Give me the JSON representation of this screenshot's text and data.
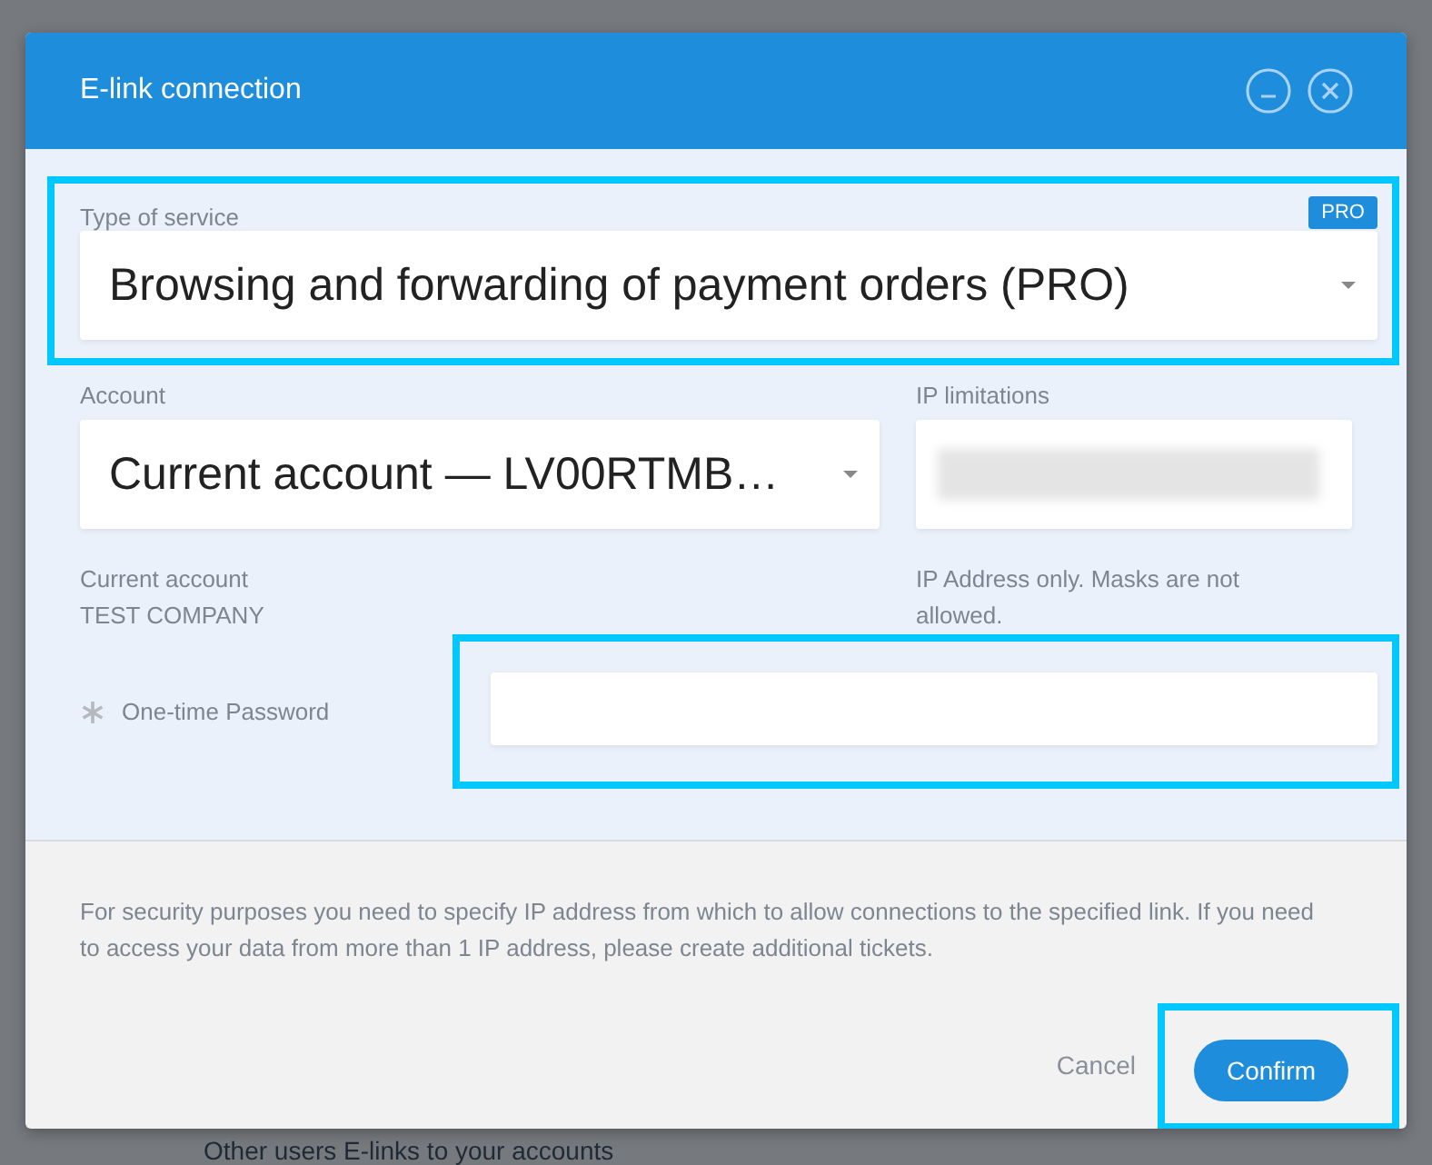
{
  "background": {
    "text": "Other users E-links to your accounts"
  },
  "dialog": {
    "title": "E-link connection"
  },
  "service": {
    "label": "Type of service",
    "badge": "PRO",
    "value": "Browsing and forwarding of payment orders (PRO)",
    "highlighted": true
  },
  "account": {
    "label": "Account",
    "value": "Current account — LV00RTMB…",
    "note_lines": [
      "Current account",
      "TEST COMPANY"
    ]
  },
  "ip": {
    "label": "IP limitations",
    "note": "IP Address only. Masks are not allowed."
  },
  "password": {
    "label": "One-time Password",
    "required": true,
    "highlighted": true
  },
  "footer": {
    "text": "For security purposes you need to specify IP address from which to allow connections to the specified link. If you need to access your data from more than 1 IP address, please create additional tickets.",
    "buttons": [
      {
        "label": "Cancel",
        "kind": "link",
        "highlighted": false
      },
      {
        "label": "Confirm",
        "kind": "primary",
        "highlighted": true
      }
    ]
  }
}
